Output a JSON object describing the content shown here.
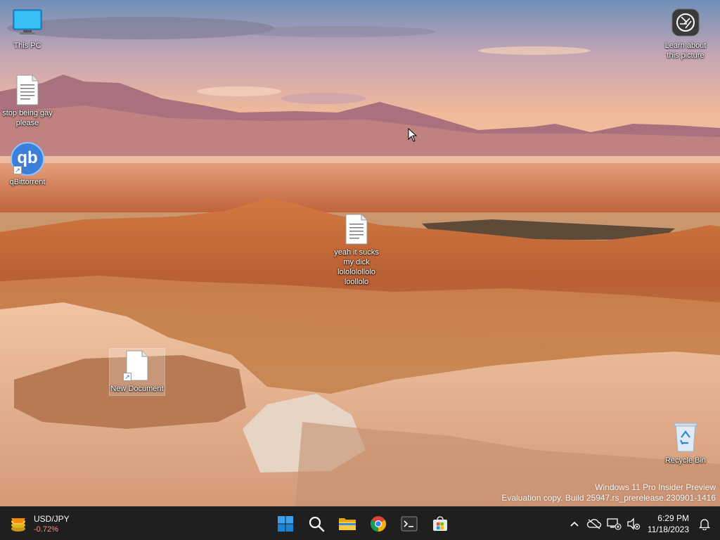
{
  "desktop": {
    "icons": [
      {
        "label": "This PC",
        "icon": "this-pc-icon"
      },
      {
        "label": "stop being gay please",
        "icon": "text-file-icon"
      },
      {
        "label": "qBittorrent",
        "icon": "qbittorrent-icon",
        "glyph": "qb"
      },
      {
        "label": "yeah it sucks my dick lolololollolo loollolo",
        "icon": "text-file-icon"
      },
      {
        "label": "New Document",
        "icon": "document-icon"
      },
      {
        "label": "Learn about this picture",
        "icon": "camera-icon"
      },
      {
        "label": "Recycle Bin",
        "icon": "recycle-bin-icon"
      }
    ],
    "watermark": {
      "line1": "Windows 11 Pro Insider Preview",
      "line2": "Evaluation copy. Build 25947.rs_prerelease.230901-1416"
    }
  },
  "taskbar": {
    "widget": {
      "pair": "USD/JPY",
      "change": "-0.72%",
      "change_color": "#ff8c8c"
    },
    "apps": [
      {
        "name": "start-button",
        "icon": "windows-logo-icon"
      },
      {
        "name": "search-button",
        "icon": "search-icon"
      },
      {
        "name": "file-explorer-button",
        "icon": "folder-icon"
      },
      {
        "name": "chrome-button",
        "icon": "chrome-icon"
      },
      {
        "name": "terminal-button",
        "icon": "terminal-icon"
      },
      {
        "name": "store-button",
        "icon": "store-icon"
      }
    ],
    "clock": {
      "time": "6:29 PM",
      "date": "11/18/2023"
    },
    "background": "#1f1f1f"
  }
}
